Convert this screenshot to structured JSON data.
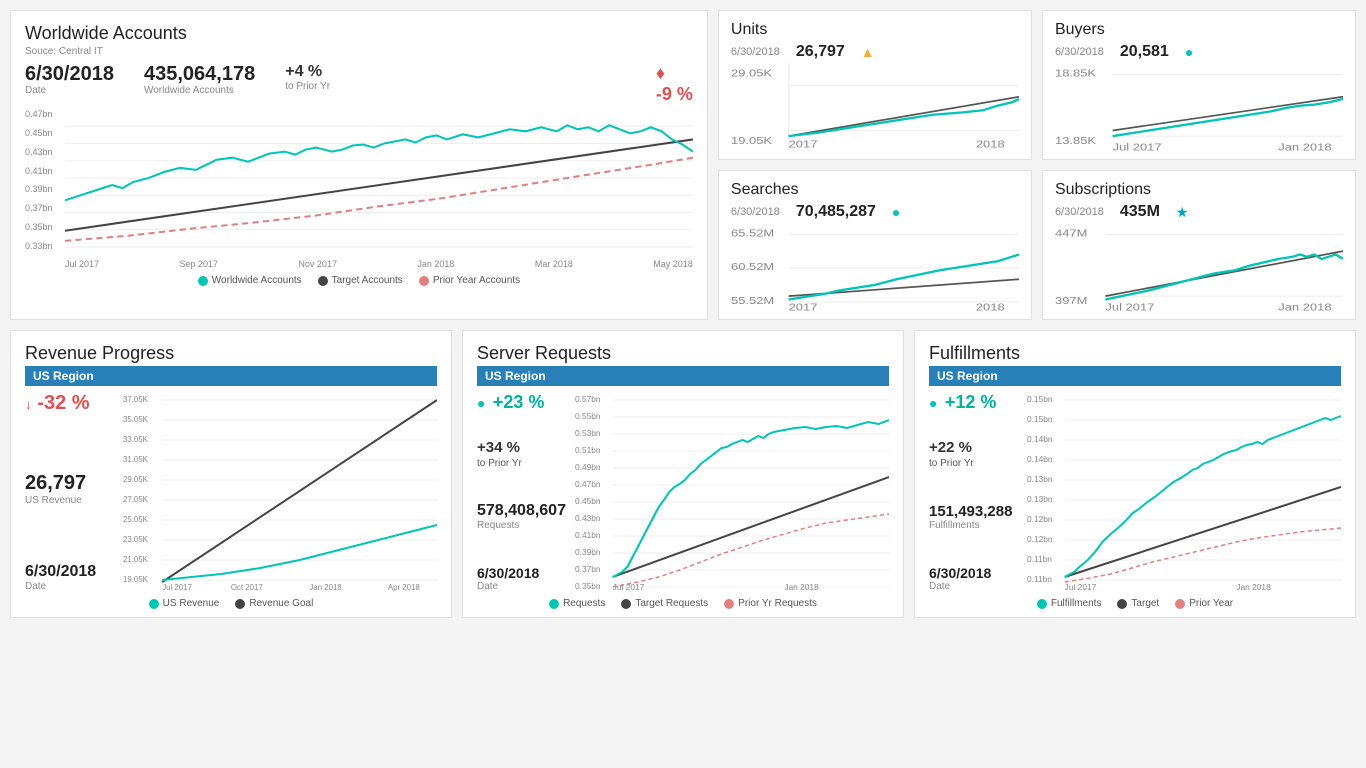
{
  "worldwide": {
    "title": "Worldwide Accounts",
    "source": "Souce: Central IT",
    "date": "6/30/2018",
    "date_label": "Date",
    "value": "435,064,178",
    "value_label": "Worldwide Accounts",
    "pct_pos": "+4 %",
    "pct_pos_label": "to Prior Yr",
    "pct_neg": "-9 %",
    "legend": [
      "Worldwide Accounts",
      "Target Accounts",
      "Prior Year Accounts"
    ],
    "y_labels": [
      "0.47bn",
      "0.45bn",
      "0.43bn",
      "0.41bn",
      "0.39bn",
      "0.37bn",
      "0.35bn",
      "0.33bn"
    ],
    "x_labels": [
      "Jul 2017",
      "Sep 2017",
      "Nov 2017",
      "Jan 2018",
      "Mar 2018",
      "May 2018"
    ]
  },
  "units": {
    "title": "Units",
    "date": "6/30/2018",
    "value": "26,797",
    "dot": "▲",
    "y_labels": [
      "29.05K",
      "19.05K"
    ],
    "x_labels": [
      "2017",
      "2018"
    ]
  },
  "buyers": {
    "title": "Buyers",
    "date": "6/30/2018",
    "value": "20,581",
    "dot": "●",
    "y_labels": [
      "18.85K",
      "13.85K"
    ],
    "x_labels": [
      "Jul 2017",
      "Jan 2018"
    ]
  },
  "searches": {
    "title": "Searches",
    "date": "6/30/2018",
    "value": "70,485,287",
    "dot": "●",
    "y_labels": [
      "65.52M",
      "60.52M",
      "55.52M"
    ],
    "x_labels": [
      "2017",
      "2018"
    ]
  },
  "subscriptions": {
    "title": "Subscriptions",
    "date": "6/30/2018",
    "value": "435M",
    "dot": "★",
    "y_labels": [
      "447M",
      "397M"
    ],
    "x_labels": [
      "Jul 2017",
      "Jan 2018"
    ]
  },
  "revenue": {
    "title": "Revenue Progress",
    "region": "US Region",
    "pct": "-32 %",
    "value": "26,797",
    "value_label": "US Revenue",
    "date": "6/30/2018",
    "date_label": "Date",
    "y_labels": [
      "37.05K",
      "35.05K",
      "33.05K",
      "31.05K",
      "29.05K",
      "27.05K",
      "25.05K",
      "23.05K",
      "21.05K",
      "19.05K"
    ],
    "x_labels": [
      "Jul 2017",
      "Oct 2017",
      "Jan 2018",
      "Apr 2018"
    ],
    "legend": [
      "US Revenue",
      "Revenue Goal"
    ]
  },
  "server": {
    "title": "Server Requests",
    "region": "US Region",
    "pct_circle": "+23 %",
    "pct_prior": "+34 %",
    "pct_prior_label": "to Prior Yr",
    "value": "578,408,607",
    "value_label": "Requests",
    "date": "6/30/2018",
    "date_label": "Date",
    "y_labels": [
      "0.57bn",
      "0.55bn",
      "0.53bn",
      "0.51bn",
      "0.49bn",
      "0.47bn",
      "0.45bn",
      "0.43bn",
      "0.41bn",
      "0.39bn",
      "0.37bn",
      "0.35bn"
    ],
    "x_labels": [
      "Jul 2017",
      "Jan 2018"
    ],
    "legend": [
      "Requests",
      "Target Requests",
      "Prior Yr Requests"
    ]
  },
  "fulfillments": {
    "title": "Fulfillments",
    "region": "US Region",
    "pct_circle": "+12 %",
    "pct_prior": "+22 %",
    "pct_prior_label": "to Prior Yr",
    "value": "151,493,288",
    "value_label": "Fulfillments",
    "date": "6/30/2018",
    "date_label": "Date",
    "y_labels": [
      "0.15bn",
      "0.15bn",
      "0.14bn",
      "0.14bn",
      "0.13bn",
      "0.13bn",
      "0.12bn",
      "0.12bn",
      "0.11bn",
      "0.11bn"
    ],
    "x_labels": [
      "Jul 2017",
      "Jan 2018"
    ],
    "legend": [
      "Fulfillments",
      "Target",
      "Prior Year"
    ]
  },
  "colors": {
    "teal": "#00c4b4",
    "dark": "#444",
    "red_dashed": "#e08080",
    "blue_region": "#2980b9",
    "amber": "#f0b030"
  }
}
